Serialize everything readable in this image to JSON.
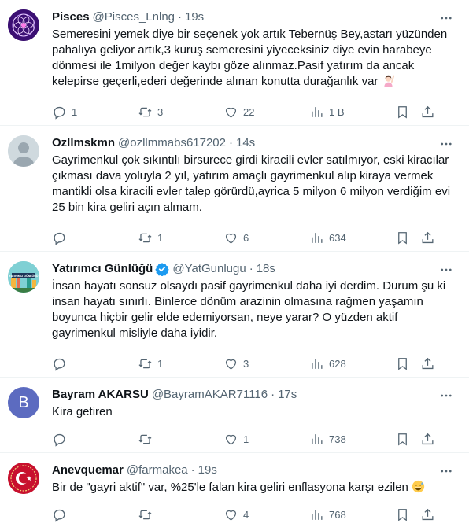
{
  "colors": {
    "text": "#0f1419",
    "muted": "#536471",
    "border": "#eff3f4",
    "verified": "#1d9bf0",
    "bayram_avatar": "#5c6bc0"
  },
  "tweets": [
    {
      "display_name": "Pisces",
      "handle": "@Pisces_Lnlng",
      "dot": "·",
      "time": "19s",
      "text": "Semeresini yemek diye bir seçenek yok artık Tebernüş Bey,astarı yüzünden pahalıya geliyor artık,3 kuruş semeresini yiyeceksiniz diye evin harabeye dönmesi ile 1milyon değer kaybı göze alınmaz.Pasif yatırım da ancak kelepirse geçerli,ederi değerinde alınan konutta durağanlık var",
      "emoji": "woman-raising-hand",
      "replies": "1",
      "retweets": "3",
      "likes": "22",
      "views": "1 B",
      "avatar_icon": "sacred-geometry-avatar"
    },
    {
      "display_name": "Ozllmskmn",
      "handle": "@ozllmmabs617202",
      "dot": "·",
      "time": "14s",
      "text": "Gayrimenkul çok sıkıntılı birsurece girdi kiracili evler satılmıyor, eski kiracılar çıkması dava yoluyla 2 yıl, yatırım amaçlı gayrimenkul alıp kiraya vermek mantikli olsa kiracili evler talep görürdü,ayrica 5 milyon 6 milyon verdiğim evi 25 bin kira geliri açın almam.",
      "replies": "",
      "retweets": "1",
      "likes": "6",
      "views": "634",
      "avatar_icon": "default-profile-avatar"
    },
    {
      "display_name": "Yatırımcı Günlüğü",
      "handle": "@YatGunlugu",
      "dot": "·",
      "time": "18s",
      "text": "İnsan hayatı sonsuz olsaydı pasif gayrimenkul daha iyi derdim. Durum şu ki insan hayatı sınırlı. Binlerce dönüm arazinin olmasına rağmen yaşamın boyunca hiçbir gelir elde edemiyorsan, neye yarar? O yüzden aktif gayrimenkul misliyle daha iyidir.",
      "replies": "",
      "retweets": "1",
      "likes": "3",
      "views": "628",
      "avatar_icon": "city-illustration-avatar",
      "avatar_text": "YATIRIMCI GÜNLÜĞÜ"
    },
    {
      "display_name": "Bayram AKARSU",
      "handle": "@BayramAKAR71116",
      "dot": "·",
      "time": "17s",
      "text": "Kira getiren",
      "replies": "",
      "retweets": "",
      "likes": "1",
      "views": "738",
      "avatar_letter": "B"
    },
    {
      "display_name": "Anevquemar",
      "handle": "@farmakea",
      "dot": "·",
      "time": "19s",
      "text": "Bir de \"gayri aktif\" var, %25'le falan kira geliri enflasyona karşı ezilen",
      "emoji": "grinning-sweat-face",
      "replies": "",
      "retweets": "",
      "likes": "4",
      "views": "768",
      "avatar_icon": "crescent-star-emblem-avatar"
    }
  ]
}
